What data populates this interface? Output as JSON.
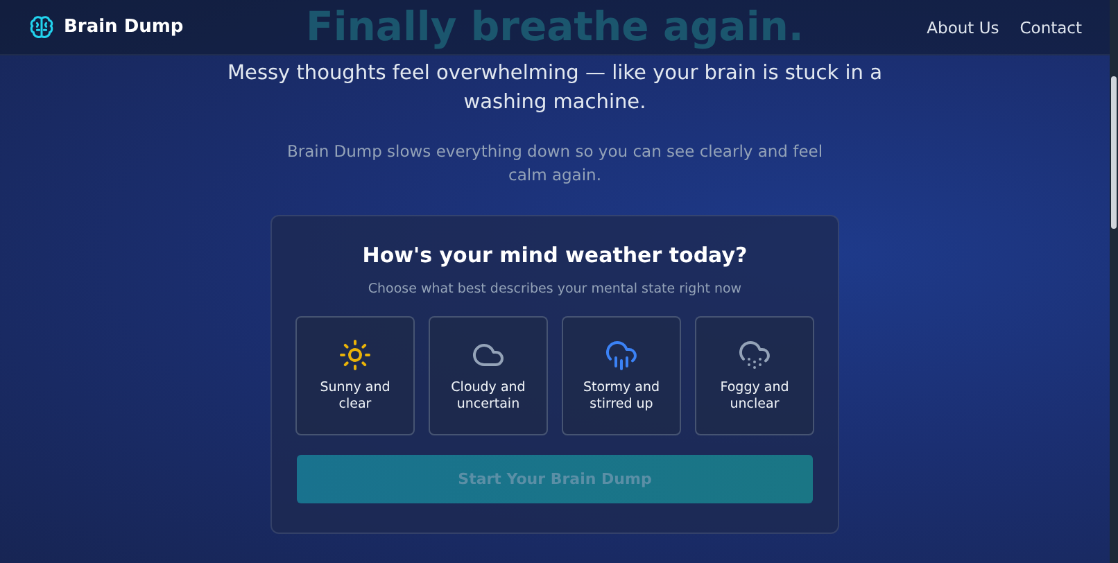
{
  "header": {
    "brand": "Brain Dump",
    "nav": [
      {
        "label": "About Us"
      },
      {
        "label": "Contact"
      }
    ]
  },
  "hero": {
    "title": "Finally breathe again.",
    "tagline": "Messy thoughts feel overwhelming — like your brain is stuck in a washing machine.",
    "description": "Brain Dump slows everything down so you can see clearly and feel calm again."
  },
  "card": {
    "title": "How's your mind weather today?",
    "subtitle": "Choose what best describes your mental state right now",
    "moods": [
      {
        "kind": "sunny",
        "label": "Sunny and clear",
        "selected": false
      },
      {
        "kind": "cloudy",
        "label": "Cloudy and uncertain",
        "selected": false
      },
      {
        "kind": "stormy",
        "label": "Stormy and stirred up",
        "selected": false
      },
      {
        "kind": "foggy",
        "label": "Foggy and unclear",
        "selected": false
      }
    ],
    "button": {
      "label": "Start Your Brain Dump",
      "disabled": true
    }
  }
}
